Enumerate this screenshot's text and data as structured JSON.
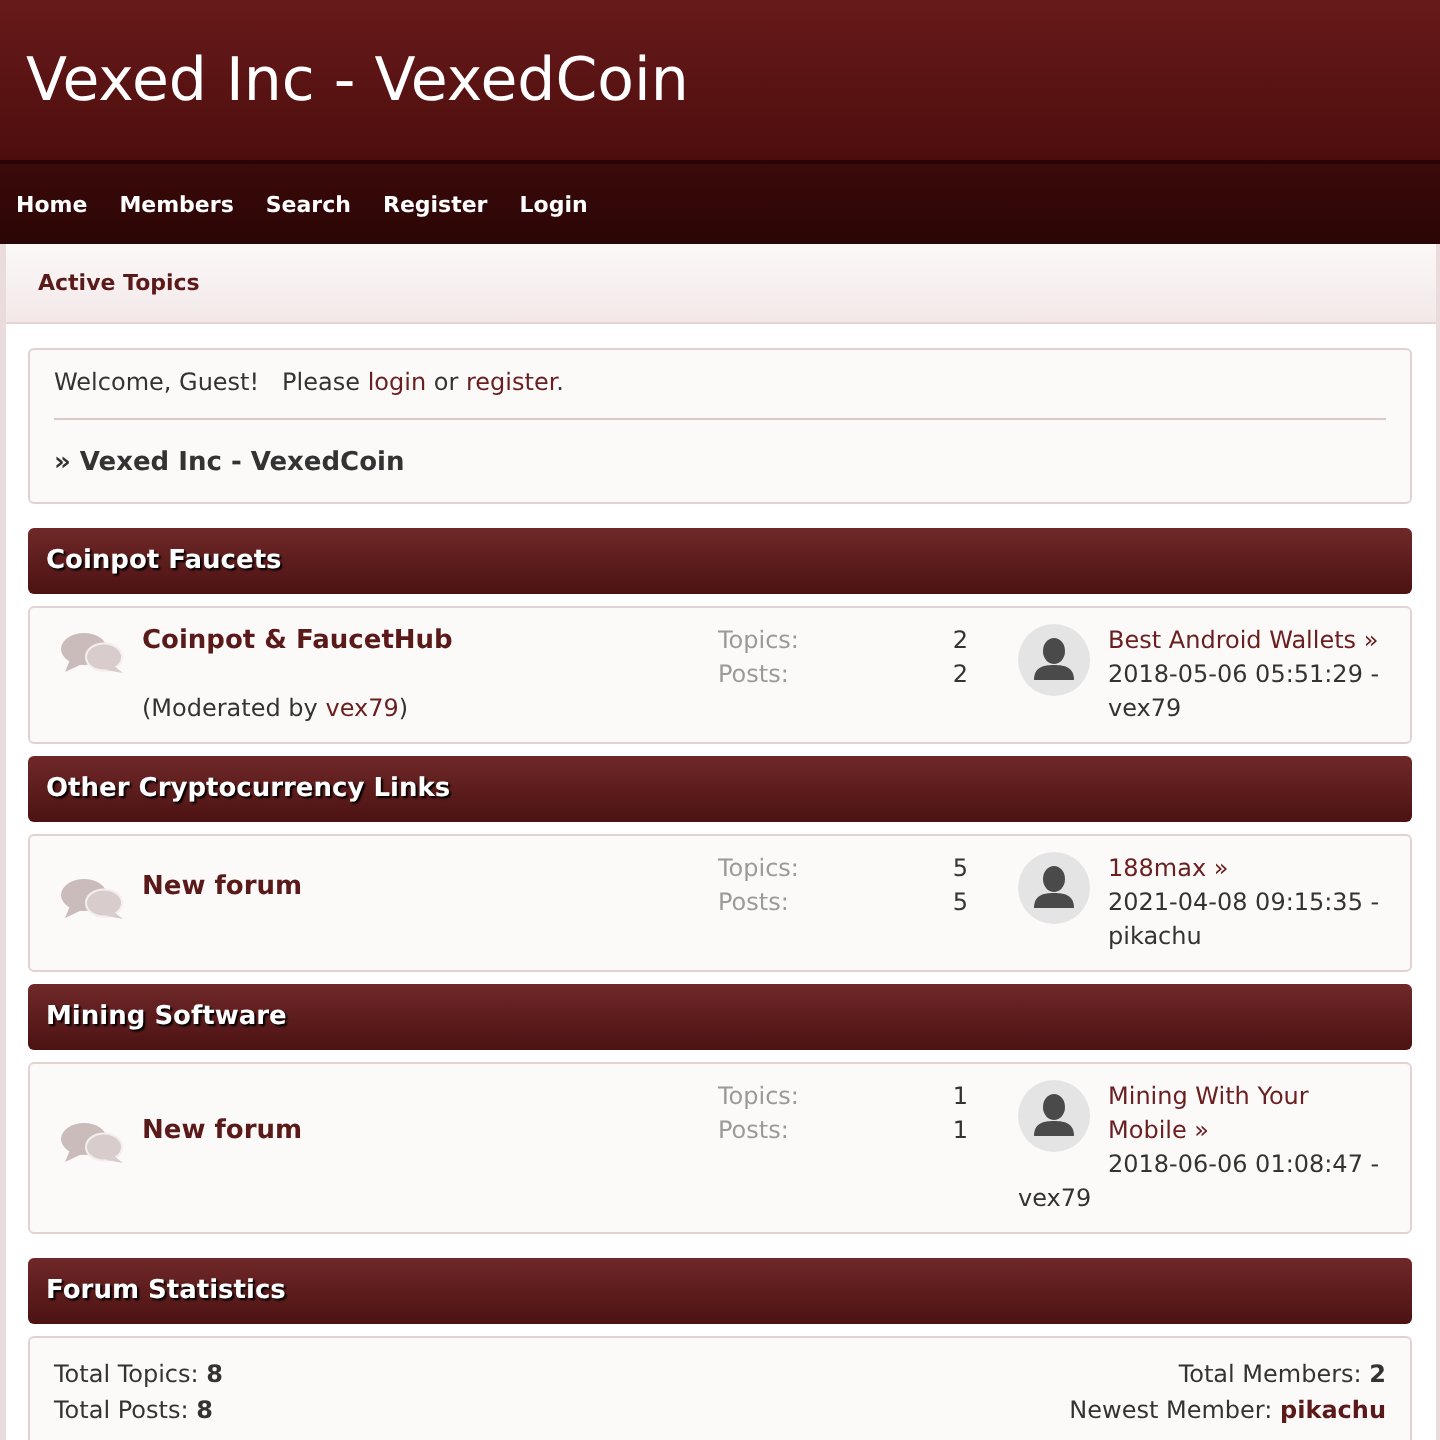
{
  "header": {
    "title": "Vexed Inc - VexedCoin"
  },
  "nav": [
    "Home",
    "Members",
    "Search",
    "Register",
    "Login"
  ],
  "subnav": {
    "label": "Active Topics"
  },
  "welcome": {
    "greeting": "Welcome, Guest!",
    "prompt": "Please",
    "login": "login",
    "joiner": "or",
    "register": "register",
    "end": "."
  },
  "breadcrumb": "» Vexed Inc - VexedCoin",
  "categories": [
    {
      "title": "Coinpot Faucets",
      "forums": [
        {
          "name": "Coinpot & FaucetHub",
          "moderation": {
            "label": "(Moderated by",
            "user": "vex79",
            "close": ")"
          },
          "stats": [
            {
              "label": "Topics:",
              "value": "2"
            },
            {
              "label": "Posts:",
              "value": "2"
            }
          ],
          "last_post": {
            "title": "Best Android Wallets »",
            "info": "2018-05-06 05:51:29 - vex79"
          }
        }
      ]
    },
    {
      "title": "Other Cryptocurrency Links",
      "forums": [
        {
          "name": "New forum",
          "stats": [
            {
              "label": "Topics:",
              "value": "5"
            },
            {
              "label": "Posts:",
              "value": "5"
            }
          ],
          "last_post": {
            "title": "188max »",
            "info": "2021-04-08 09:15:35 - pikachu"
          }
        }
      ]
    },
    {
      "title": "Mining Software",
      "forums": [
        {
          "name": "New forum",
          "stats": [
            {
              "label": "Topics:",
              "value": "1"
            },
            {
              "label": "Posts:",
              "value": "1"
            }
          ],
          "last_post": {
            "title": "Mining With Your Mobile »",
            "info": "2018-06-06 01:08:47 - vex79"
          }
        }
      ]
    }
  ],
  "statistics": {
    "title": "Forum Statistics",
    "left": [
      "Total Topics: **8**",
      "Total Posts: **8**"
    ],
    "right": [
      {
        "kind": "count",
        "text": "Total Members: **2**"
      },
      {
        "kind": "member",
        "label": "Newest Member:",
        "user": "pikachu"
      }
    ]
  }
}
